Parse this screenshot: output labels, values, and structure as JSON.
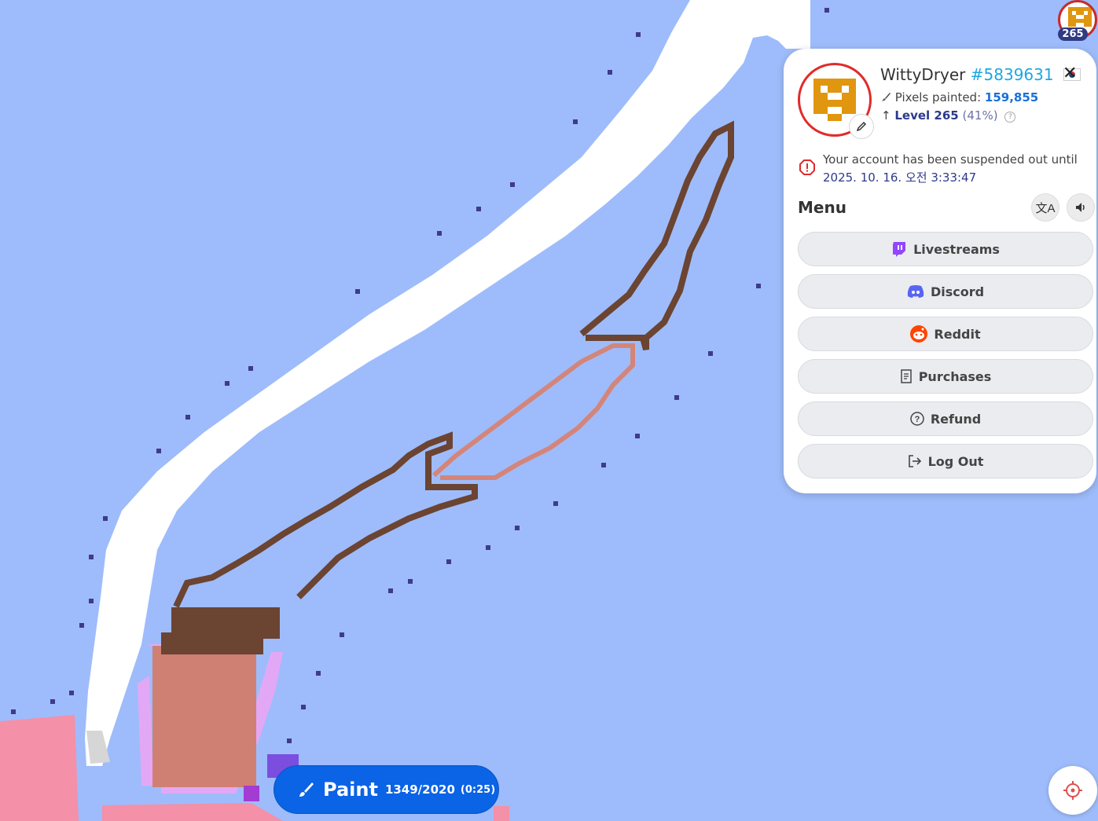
{
  "profile": {
    "username": "WittyDryer",
    "user_id": "#5839631",
    "flag": "south-korea-flag",
    "pixels_label": "Pixels painted:",
    "pixels_value": "159,855",
    "level_label": "Level 265",
    "level_percent": "(41%)",
    "level_badge": "265",
    "suspension_text": "Your account has been suspended out until",
    "suspension_until": "2025. 10. 16. 오전 3:33:47"
  },
  "menu": {
    "title": "Menu",
    "items": [
      {
        "label": "Livestreams",
        "icon": "twitch-icon"
      },
      {
        "label": "Discord",
        "icon": "discord-icon"
      },
      {
        "label": "Reddit",
        "icon": "reddit-icon"
      },
      {
        "label": "Purchases",
        "icon": "receipt-icon"
      },
      {
        "label": "Refund",
        "icon": "question-circle-icon"
      },
      {
        "label": "Log Out",
        "icon": "logout-icon"
      }
    ],
    "translate_icon": "translate-icon",
    "sound_icon": "speaker-icon"
  },
  "paint": {
    "label": "Paint",
    "charges": "1349/2020",
    "timer": "(0:25)"
  },
  "colors": {
    "canvas_bg": "#9ebcfb",
    "accent": "#0b63e5",
    "avatar_orange": "#e0960f",
    "danger": "#e02b2b"
  }
}
